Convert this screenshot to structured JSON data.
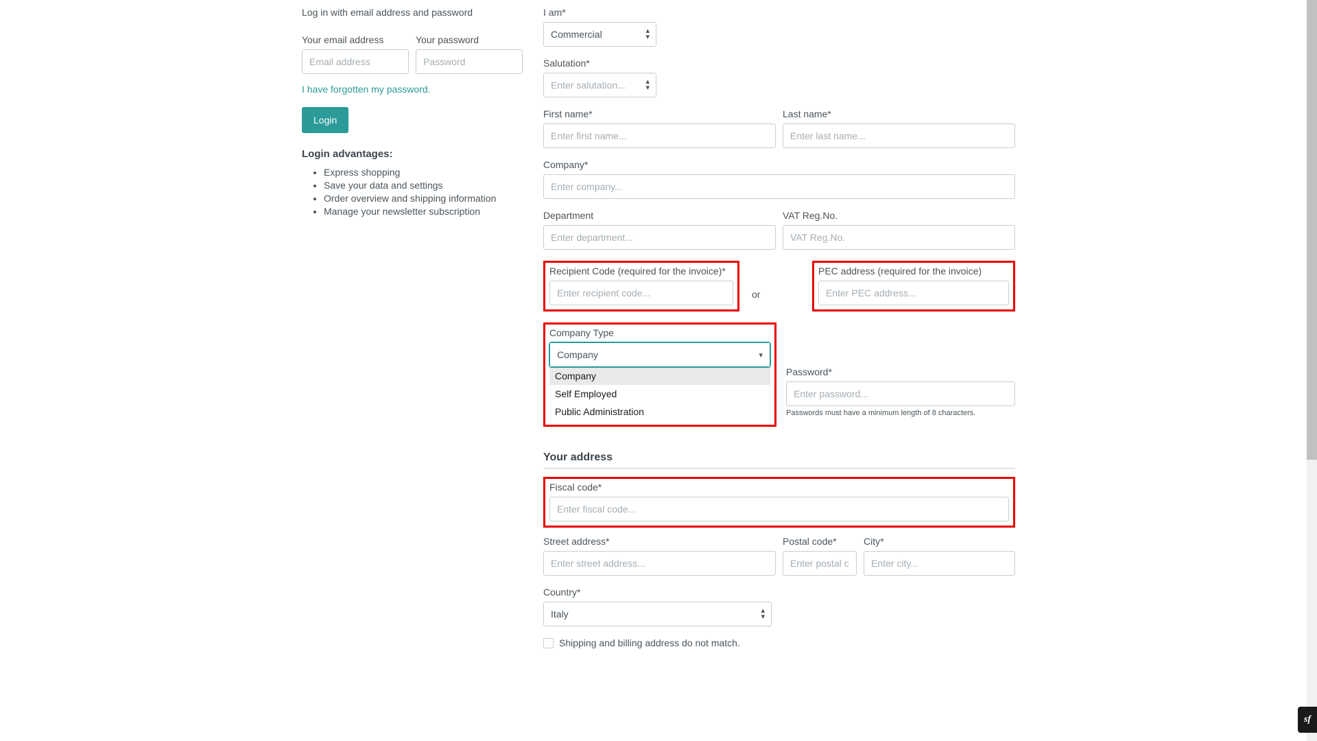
{
  "login": {
    "intro": "Log in with email address and password",
    "email_label": "Your email address",
    "email_placeholder": "Email address",
    "password_label": "Your password",
    "password_placeholder": "Password",
    "forgot_link": "I have forgotten my password.",
    "login_button": "Login",
    "advantages_title": "Login advantages:",
    "advantages": [
      "Express shopping",
      "Save your data and settings",
      "Order overview and shipping information",
      "Manage your newsletter subscription"
    ]
  },
  "register": {
    "iam_label": "I am*",
    "iam_value": "Commercial",
    "salutation_label": "Salutation*",
    "salutation_placeholder": "Enter salutation...",
    "firstname_label": "First name*",
    "firstname_placeholder": "Enter first name...",
    "lastname_label": "Last name*",
    "lastname_placeholder": "Enter last name...",
    "company_label": "Company*",
    "company_placeholder": "Enter company...",
    "department_label": "Department",
    "department_placeholder": "Enter department...",
    "vat_label": "VAT Reg.No.",
    "vat_placeholder": "VAT Reg.No.",
    "recipient_label": "Recipient Code (required for the invoice)*",
    "recipient_placeholder": "Enter recipient code...",
    "or_text": "or",
    "pec_label": "PEC address (required for the invoice)",
    "pec_placeholder": "Enter PEC address...",
    "companytype_label": "Company Type",
    "companytype_value": "Company",
    "companytype_options": [
      "Company",
      "Self Employed",
      "Public Administration"
    ],
    "password_label": "Password*",
    "password_placeholder": "Enter password...",
    "password_hint": "Passwords must have a minimum length of 8 characters.",
    "address_section_title": "Your address",
    "fiscal_label": "Fiscal code*",
    "fiscal_placeholder": "Enter fiscal code...",
    "street_label": "Street address*",
    "street_placeholder": "Enter street address...",
    "postal_label": "Postal code*",
    "postal_placeholder": "Enter postal code...",
    "city_label": "City*",
    "city_placeholder": "Enter city...",
    "country_label": "Country*",
    "country_value": "Italy",
    "address_mismatch": "Shipping and billing address do not match."
  },
  "sf_badge": "sf"
}
